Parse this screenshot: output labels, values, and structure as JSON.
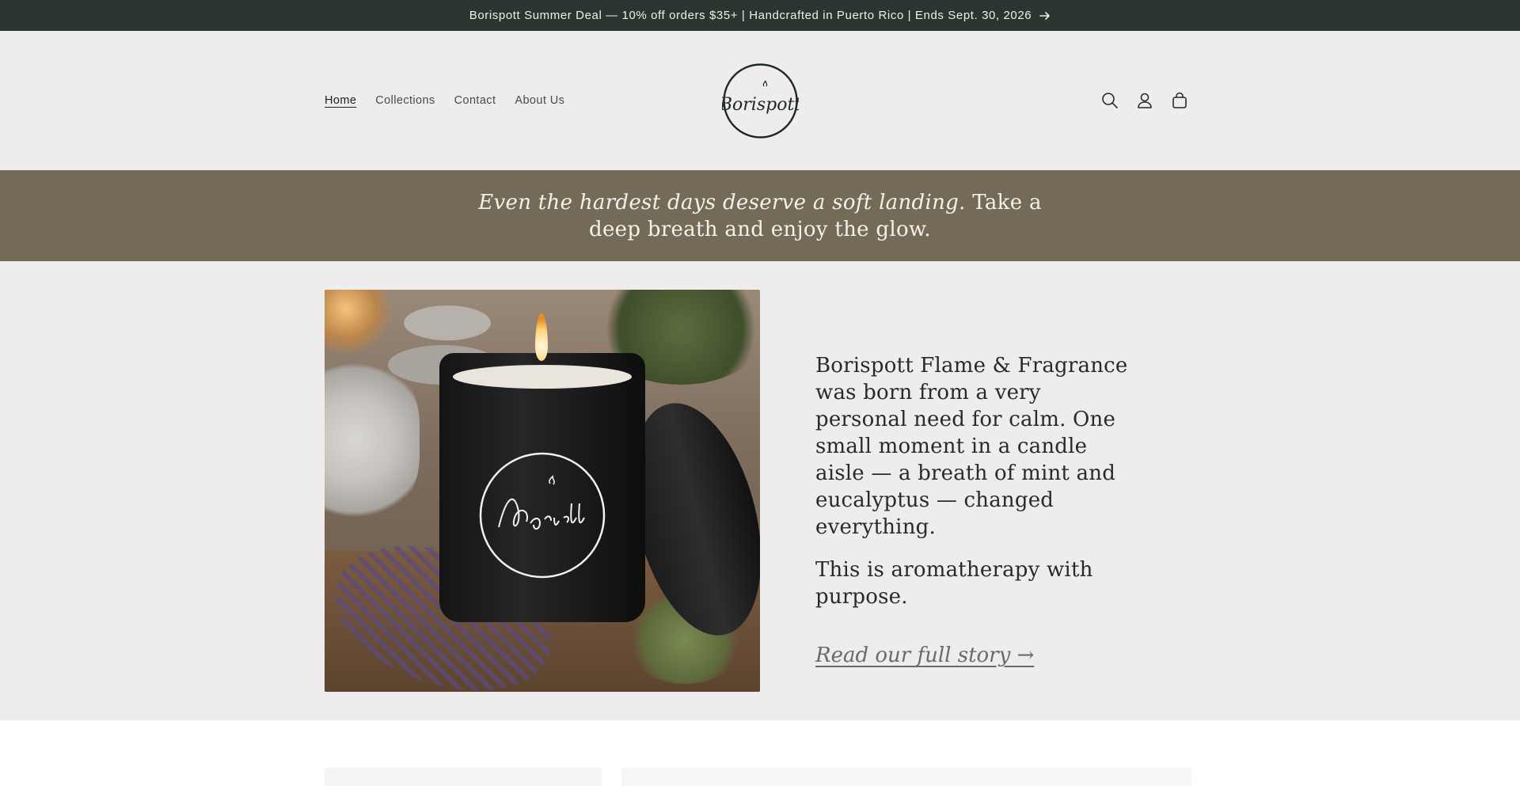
{
  "announcement": {
    "text": "Borispott Summer Deal — 10% off orders $35+ | Handcrafted in Puerto Rico | Ends Sept. 30, 2026",
    "arrow": "→"
  },
  "header": {
    "nav": [
      {
        "label": "Home",
        "active": true
      },
      {
        "label": "Collections",
        "active": false
      },
      {
        "label": "Contact",
        "active": false
      },
      {
        "label": "About Us",
        "active": false
      }
    ],
    "logo_text": "Borispott",
    "icons": [
      "search-icon",
      "account-icon",
      "cart-icon"
    ]
  },
  "quote": {
    "italic": "Even the hardest days deserve a soft landing.",
    "rest": " Take a deep breath and enjoy the glow."
  },
  "story": {
    "paragraph1": "Borispott Flame & Fragrance was born from a very personal need for calm. One small moment in a candle aisle — a breath of mint and eucalyptus — changed everything.",
    "paragraph2": "This is aromatherapy with purpose.",
    "link": "Read our full story →"
  },
  "colors": {
    "announcement_bg": "#2b3630",
    "header_bg": "#eeecec",
    "quote_bg": "#736b58"
  }
}
